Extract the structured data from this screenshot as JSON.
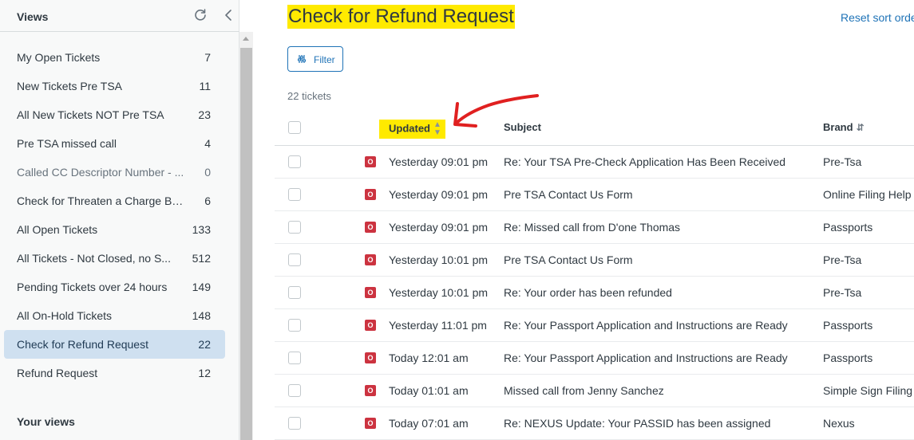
{
  "sidebar": {
    "title": "Views",
    "items": [
      {
        "label": "My Open Tickets",
        "count": "7"
      },
      {
        "label": "New Tickets Pre TSA",
        "count": "11"
      },
      {
        "label": "All New Tickets NOT Pre TSA",
        "count": "23"
      },
      {
        "label": "Pre TSA missed call",
        "count": "4"
      },
      {
        "label": "Called CC Descriptor Number - ...",
        "count": "0"
      },
      {
        "label": "Check for Threaten a Charge Back",
        "count": "6"
      },
      {
        "label": "All Open Tickets",
        "count": "133"
      },
      {
        "label": "All Tickets - Not Closed, no S...",
        "count": "512"
      },
      {
        "label": "Pending Tickets over 24 hours",
        "count": "149"
      },
      {
        "label": "All On-Hold Tickets",
        "count": "148"
      },
      {
        "label": "Check for Refund Request",
        "count": "22"
      },
      {
        "label": "Refund Request",
        "count": "12"
      }
    ],
    "your_views": "Your views"
  },
  "main": {
    "title": "Check for Refund Request",
    "reset_sort": "Reset sort orde",
    "filter_label": "Filter",
    "ticket_count": "22 tickets",
    "columns": {
      "updated": "Updated",
      "subject": "Subject",
      "brand": "Brand"
    },
    "status_letter": "O",
    "rows": [
      {
        "updated": "Yesterday 09:01 pm",
        "subject": "Re: Your TSA Pre-Check Application Has Been Received",
        "brand": "Pre-Tsa"
      },
      {
        "updated": "Yesterday 09:01 pm",
        "subject": "Pre TSA Contact Us Form",
        "brand": "Online Filing Help"
      },
      {
        "updated": "Yesterday 09:01 pm",
        "subject": "Re: Missed call from D'one Thomas",
        "brand": "Passports"
      },
      {
        "updated": "Yesterday 10:01 pm",
        "subject": "Pre TSA Contact Us Form",
        "brand": "Pre-Tsa"
      },
      {
        "updated": "Yesterday 10:01 pm",
        "subject": "Re: Your order has been refunded",
        "brand": "Pre-Tsa"
      },
      {
        "updated": "Yesterday 11:01 pm",
        "subject": "Re: Your Passport Application and Instructions are Ready",
        "brand": "Passports"
      },
      {
        "updated": "Today 12:01 am",
        "subject": "Re: Your Passport Application and Instructions are Ready",
        "brand": "Passports"
      },
      {
        "updated": "Today 01:01 am",
        "subject": "Missed call from Jenny Sanchez",
        "brand": "Simple Sign Filing"
      },
      {
        "updated": "Today 07:01 am",
        "subject": "Re: NEXUS Update: Your PASSID has been assigned",
        "brand": "Nexus"
      }
    ]
  },
  "colors": {
    "highlight": "#ffea00",
    "active_view": "#cfe0f0",
    "link": "#1f73b7",
    "status_open": "#cc3340",
    "annotation_arrow": "#e02020"
  }
}
